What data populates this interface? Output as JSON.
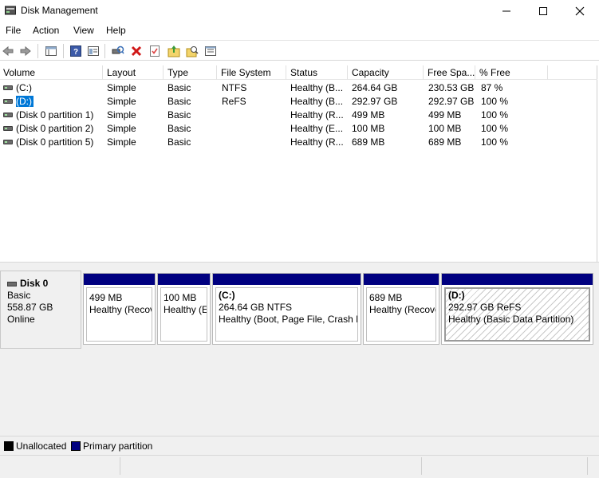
{
  "window": {
    "title": "Disk Management",
    "app_icon": "disk-management-icon"
  },
  "menu": [
    "File",
    "Action",
    "View",
    "Help"
  ],
  "toolbar": [
    "back-icon",
    "forward-icon",
    "properties-pane-icon",
    "help-icon",
    "show-hide-icon",
    "connect-icon",
    "delete-icon",
    "checklist-icon",
    "up-folder-icon",
    "search-folder-icon",
    "console-icon"
  ],
  "volume_list": {
    "columns": [
      "Volume",
      "Layout",
      "Type",
      "File System",
      "Status",
      "Capacity",
      "Free Spa...",
      "% Free"
    ],
    "rows": [
      {
        "volume": "(C:)",
        "layout": "Simple",
        "type": "Basic",
        "fs": "NTFS",
        "status": "Healthy (B...",
        "capacity": "264.64 GB",
        "free": "230.53 GB",
        "pct": "87 %"
      },
      {
        "volume": "(D:)",
        "layout": "Simple",
        "type": "Basic",
        "fs": "ReFS",
        "status": "Healthy (B...",
        "capacity": "292.97 GB",
        "free": "292.97 GB",
        "pct": "100 %"
      },
      {
        "volume": "(Disk 0 partition 1)",
        "layout": "Simple",
        "type": "Basic",
        "fs": "",
        "status": "Healthy (R...",
        "capacity": "499 MB",
        "free": "499 MB",
        "pct": "100 %"
      },
      {
        "volume": "(Disk 0 partition 2)",
        "layout": "Simple",
        "type": "Basic",
        "fs": "",
        "status": "Healthy (E...",
        "capacity": "100 MB",
        "free": "100 MB",
        "pct": "100 %"
      },
      {
        "volume": "(Disk 0 partition 5)",
        "layout": "Simple",
        "type": "Basic",
        "fs": "",
        "status": "Healthy (R...",
        "capacity": "689 MB",
        "free": "689 MB",
        "pct": "100 %"
      }
    ],
    "selected_row": 1
  },
  "disk": {
    "name": "Disk 0",
    "type": "Basic",
    "size": "558.87 GB",
    "state": "Online",
    "partitions": [
      {
        "name": "",
        "size": "499 MB",
        "status": "Healthy (Recovery Partition)"
      },
      {
        "name": "",
        "size": "100 MB",
        "status": "Healthy (EFI System Partition)"
      },
      {
        "name": "(C:)",
        "size": "264.64 GB NTFS",
        "status": "Healthy (Boot, Page File, Crash Dump, Basic Data Partition)"
      },
      {
        "name": "",
        "size": "689 MB",
        "status": "Healthy (Recovery Partition)"
      },
      {
        "name": "(D:)",
        "size": "292.97 GB ReFS",
        "status": "Healthy (Basic Data Partition)"
      }
    ]
  },
  "legend": [
    {
      "label": "Unallocated",
      "color": "#000000"
    },
    {
      "label": "Primary partition",
      "color": "#000080"
    }
  ],
  "colors": {
    "primary": "#000080",
    "unallocated": "#000000",
    "selection": "#0078d7"
  }
}
